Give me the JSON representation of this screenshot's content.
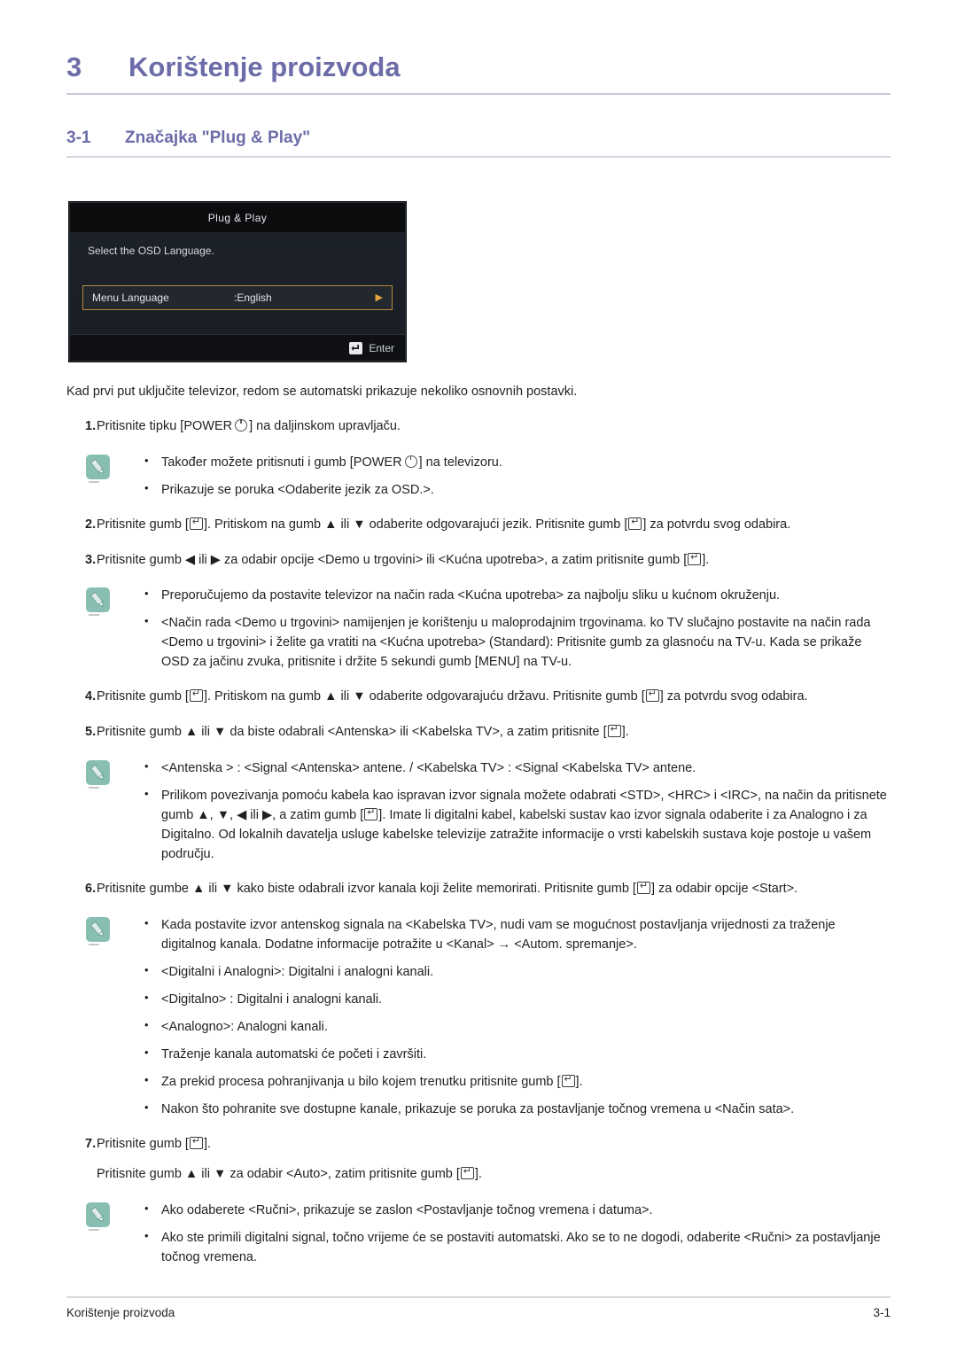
{
  "chapter": {
    "number": "3",
    "title": "Korištenje proizvoda"
  },
  "section": {
    "number": "3-1",
    "title": "Značajka \"Plug & Play\""
  },
  "osd": {
    "title": "Plug & Play",
    "prompt": "Select the OSD Language.",
    "row_label": "Menu Language",
    "row_value": ":English",
    "row_arrow": "▶",
    "footer_label": "Enter",
    "highlight_color": "#b88a3c",
    "background_color": "#191d23"
  },
  "intro": "Kad prvi put uključite televizor, redom se automatski prikazuje nekoliko osnovnih postavki.",
  "steps": [
    {
      "num": "1.",
      "pre": "Pritisnite tipku [POWER",
      "post": "] na daljinskom upravljaču."
    },
    {
      "num": "2.",
      "t1": "Pritisnite gumb [",
      "t2": "]. Pritiskom na gumb ▲ ili ▼ odaberite odgovarajući jezik. Pritisnite gumb [",
      "t3": "] za potvrdu svog odabira."
    },
    {
      "num": "3.",
      "t1": "Pritisnite gumb ◀ ili ▶ za odabir opcije <Demo u trgovini> ili <Kućna upotreba>, a zatim pritisnite gumb [",
      "t2": "]."
    },
    {
      "num": "4.",
      "t1": "Pritisnite gumb [",
      "t2": "]. Pritiskom na gumb ▲ ili ▼ odaberite odgovarajuću državu. Pritisnite gumb [",
      "t3": "] za potvrdu svog odabira."
    },
    {
      "num": "5.",
      "t1": "Pritisnite gumb ▲ ili ▼ da biste odabrali <Antenska> ili <Kabelska TV>, a zatim pritisnite [",
      "t2": "]."
    },
    {
      "num": "6.",
      "t1": "Pritisnite gumbe ▲ ili ▼ kako biste odabrali izvor kanala koji želite memorirati. Pritisnite gumb [",
      "t2": "] za odabir opcije <Start>."
    },
    {
      "num": "7.",
      "t1": "Pritisnite gumb [",
      "t2": "].",
      "extra1": "Pritisnite gumb ▲ ili ▼ za odabir <Auto>, zatim pritisnite gumb [",
      "extra2": "]."
    }
  ],
  "notes": {
    "note1": {
      "b1_pre": "Također možete pritisnuti i gumb [POWER",
      "b1_post": "] na televizoru.",
      "b2": "Prikazuje se poruka <Odaberite jezik za OSD.>."
    },
    "note2": {
      "b1": "Preporučujemo da postavite televizor na način rada <Kućna upotreba> za najbolju sliku u kućnom okruženju.",
      "b2": "<Način rada <Demo u trgovini> namijenjen je korištenju u maloprodajnim trgovinama. ko TV slučajno postavite na način rada <Demo u trgovini> i želite ga vratiti na <Kućna upotreba> (Standard): Pritisnite gumb za glasnoću na TV-u. Kada se prikaže OSD za jačinu zvuka, pritisnite i držite 5 sekundi gumb [MENU] na TV-u."
    },
    "note3": {
      "b1": "<Antenska > : <Signal <Antenska> antene. / <Kabelska TV> : <Signal <Kabelska TV> antene.",
      "b2_pre": "Prilikom povezivanja pomoću kabela kao ispravan izvor signala možete odabrati <STD>, <HRC> i <IRC>, na način da pritisnete gumb ▲, ▼, ◀ ili ▶, a zatim gumb [",
      "b2_post": "]. Imate li digitalni kabel, kabelski sustav kao izvor signala odaberite i za Analogno i za Digitalno. Od lokalnih davatelja usluge kabelske televizije zatražite informacije o vrsti kabelskih sustava koje postoje u vašem području."
    },
    "note4": {
      "b1": "Kada postavite izvor antenskog signala na <Kabelska TV>, nudi vam se mogućnost postavljanja vrijednosti za traženje digitalnog kanala. Dodatne informacije potražite u <Kanal> → <Autom. spremanje>.",
      "b2": "<Digitalni i Analogni>: Digitalni i analogni kanali.",
      "b3": "<Digitalno> : Digitalni i analogni kanali.",
      "b4": "<Analogno>: Analogni kanali.",
      "b5": "Traženje kanala automatski će početi i završiti.",
      "b6_pre": "Za prekid procesa pohranjivanja u bilo kojem trenutku pritisnite gumb [",
      "b6_post": "].",
      "b7": "Nakon što pohranite sve dostupne kanale, prikazuje se poruka za postavljanje točnog vremena u <Način sata>."
    },
    "note5": {
      "b1": "Ako odaberete <Ručni>, prikazuje se zaslon <Postavljanje točnog vremena i datuma>.",
      "b2": "Ako ste primili digitalni signal, točno vrijeme će se postaviti automatski. Ako se to ne dogodi, odaberite <Ručni> za postavljanje točnog vremena."
    }
  },
  "footer": {
    "left": "Korištenje proizvoda",
    "right": "3-1"
  }
}
